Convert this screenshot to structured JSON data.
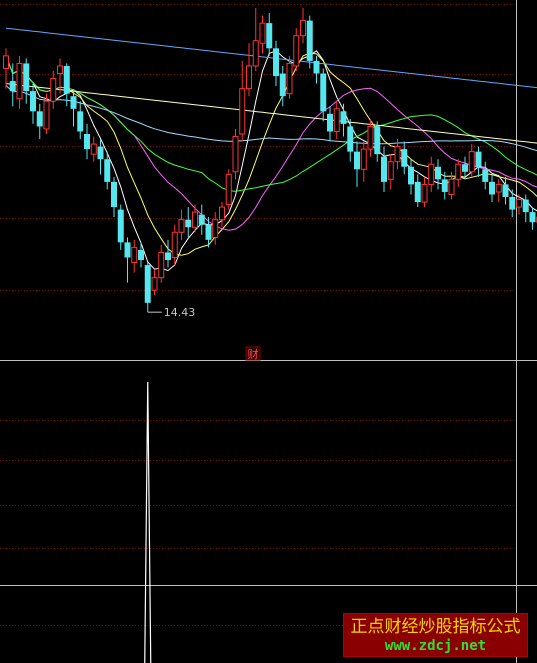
{
  "chart_data": [
    {
      "type": "candlestick",
      "panel": "price",
      "low_marker": {
        "label": "14.43",
        "value": 14.43
      },
      "badge": "财",
      "ylim": [
        14,
        26.5
      ],
      "colors": {
        "up": "#ff3333",
        "down": "#55e6ee",
        "background": "#000000",
        "grid": "#8a0000"
      },
      "candles": [
        [
          24.1,
          24.6,
          24.9,
          23.3
        ],
        [
          23.6,
          23.2,
          24.3,
          22.6
        ],
        [
          22.9,
          24.3,
          24.6,
          22.5
        ],
        [
          24.3,
          23.2,
          24.5,
          22.7
        ],
        [
          23.2,
          22.4,
          23.5,
          21.9
        ],
        [
          22.4,
          21.8,
          22.7,
          21.3
        ],
        [
          21.7,
          22.8,
          23.1,
          21.5
        ],
        [
          22.8,
          23.7,
          24.0,
          22.5
        ],
        [
          23.9,
          24.2,
          24.5,
          23.1
        ],
        [
          24.2,
          23.1,
          24.3,
          22.6
        ],
        [
          23.0,
          22.5,
          23.2,
          21.8
        ],
        [
          22.4,
          21.6,
          22.8,
          21.3
        ],
        [
          21.5,
          20.9,
          21.9,
          20.5
        ],
        [
          20.7,
          21.1,
          21.4,
          20.4
        ],
        [
          21.0,
          20.5,
          21.3,
          19.9
        ],
        [
          20.5,
          19.6,
          20.8,
          19.3
        ],
        [
          19.6,
          18.6,
          19.8,
          18.2
        ],
        [
          18.5,
          17.2,
          18.7,
          16.9
        ],
        [
          17.2,
          16.6,
          17.4,
          15.6
        ],
        [
          16.4,
          17.0,
          17.3,
          16.0
        ],
        [
          16.9,
          16.5,
          17.2,
          16.2
        ],
        [
          16.3,
          14.8,
          16.4,
          14.43
        ],
        [
          15.3,
          15.8,
          16.1,
          15.1
        ],
        [
          15.8,
          16.8,
          17.1,
          15.6
        ],
        [
          16.8,
          16.5,
          17.3,
          16.2
        ],
        [
          16.6,
          17.6,
          17.9,
          16.3
        ],
        [
          17.6,
          18.1,
          18.5,
          17.3
        ],
        [
          18.1,
          17.8,
          18.6,
          17.4
        ],
        [
          17.8,
          18.4,
          18.7,
          17.6
        ],
        [
          18.3,
          17.9,
          18.7,
          17.5
        ],
        [
          17.9,
          17.3,
          18.2,
          17.0
        ],
        [
          17.4,
          18.1,
          18.4,
          17.1
        ],
        [
          18.1,
          18.6,
          18.8,
          17.8
        ],
        [
          18.7,
          19.9,
          20.1,
          18.5
        ],
        [
          20.0,
          21.4,
          21.7,
          19.7
        ],
        [
          21.5,
          23.3,
          24.4,
          21.2
        ],
        [
          23.3,
          24.2,
          25.1,
          23.0
        ],
        [
          24.2,
          25.2,
          26.5,
          24.0
        ],
        [
          25.1,
          25.9,
          26.2,
          24.7
        ],
        [
          25.9,
          24.9,
          26.3,
          24.6
        ],
        [
          24.9,
          23.8,
          25.2,
          23.4
        ],
        [
          23.9,
          23.0,
          24.2,
          22.6
        ],
        [
          23.1,
          24.3,
          24.6,
          22.9
        ],
        [
          24.2,
          25.4,
          25.7,
          24.0
        ],
        [
          25.4,
          26.0,
          26.5,
          25.1
        ],
        [
          26.0,
          24.4,
          26.2,
          24.1
        ],
        [
          24.4,
          23.9,
          24.6,
          23.5
        ],
        [
          23.9,
          22.4,
          24.1,
          22.0
        ],
        [
          22.3,
          21.6,
          22.6,
          21.2
        ],
        [
          21.6,
          22.5,
          22.8,
          21.3
        ],
        [
          22.4,
          21.9,
          22.7,
          21.4
        ],
        [
          21.8,
          20.8,
          22.1,
          20.4
        ],
        [
          20.8,
          20.1,
          21.2,
          19.4
        ],
        [
          20.1,
          20.9,
          21.2,
          19.6
        ],
        [
          20.9,
          21.8,
          22.1,
          20.6
        ],
        [
          21.8,
          20.7,
          22.0,
          20.4
        ],
        [
          20.6,
          19.6,
          21.0,
          19.2
        ],
        [
          19.7,
          20.4,
          20.7,
          19.3
        ],
        [
          20.4,
          21.0,
          21.3,
          20.1
        ],
        [
          20.9,
          20.2,
          21.2,
          19.9
        ],
        [
          20.2,
          19.5,
          20.5,
          19.1
        ],
        [
          19.6,
          18.8,
          19.9,
          18.6
        ],
        [
          18.8,
          19.5,
          19.8,
          18.6
        ],
        [
          19.5,
          20.3,
          20.6,
          19.2
        ],
        [
          20.2,
          19.7,
          20.5,
          19.3
        ],
        [
          19.7,
          19.2,
          20.0,
          18.9
        ],
        [
          19.1,
          19.7,
          20.0,
          18.9
        ],
        [
          19.7,
          20.3,
          20.5,
          19.4
        ],
        [
          20.3,
          20.0,
          20.6,
          19.7
        ],
        [
          20.0,
          20.8,
          21.1,
          19.8
        ],
        [
          20.8,
          20.2,
          21.0,
          19.8
        ],
        [
          20.1,
          19.6,
          20.4,
          19.3
        ],
        [
          19.6,
          19.1,
          19.9,
          18.8
        ],
        [
          19.2,
          19.5,
          19.7,
          18.8
        ],
        [
          19.5,
          19.0,
          19.8,
          18.7
        ],
        [
          19.0,
          18.5,
          19.3,
          18.2
        ],
        [
          18.6,
          18.9,
          19.1,
          18.3
        ],
        [
          18.9,
          18.4,
          19.1,
          18.0
        ],
        [
          18.4,
          18.0,
          18.6,
          17.7
        ],
        [
          18.0,
          18.2,
          18.4,
          17.5
        ]
      ],
      "moving_averages": [
        {
          "period": 5,
          "color": "#ffffff"
        },
        {
          "period": 10,
          "color": "#ffff60"
        },
        {
          "period": 20,
          "color": "#ff60ff"
        },
        {
          "period": 30,
          "color": "#40ff40"
        },
        {
          "period": 60,
          "color": "#9fdcff"
        },
        {
          "period": 120,
          "color": "#ffffc0"
        },
        {
          "period": 250,
          "color": "#60a8ff"
        }
      ]
    },
    {
      "type": "line",
      "panel": "indicator",
      "description_free": true,
      "color": "#ffffff",
      "spike_index": 21,
      "values_note_free": true,
      "values": [
        0,
        0,
        0,
        0,
        0,
        0,
        0,
        0,
        0,
        0,
        0,
        0,
        0,
        0,
        0,
        0,
        0,
        0,
        0,
        0,
        0,
        100,
        0,
        0,
        0,
        0,
        0,
        0,
        0,
        0,
        0,
        0,
        0,
        0,
        0,
        0,
        0,
        0,
        0,
        0,
        0,
        0,
        0,
        0,
        0,
        0,
        0,
        0,
        0,
        0,
        0,
        0,
        0,
        0,
        0,
        0,
        0,
        0,
        0,
        0,
        0,
        0,
        0,
        0,
        0,
        0,
        0,
        0,
        0,
        0,
        0,
        0,
        0,
        0,
        0,
        0,
        0,
        0,
        0,
        0
      ],
      "ylim": [
        0,
        100
      ]
    }
  ],
  "watermark": {
    "title": "正点财经炒股指标公式",
    "url": "www.zdcj.net",
    "colors": {
      "bg": "#8a0000",
      "title": "#ffd400",
      "url": "#30e030"
    }
  }
}
